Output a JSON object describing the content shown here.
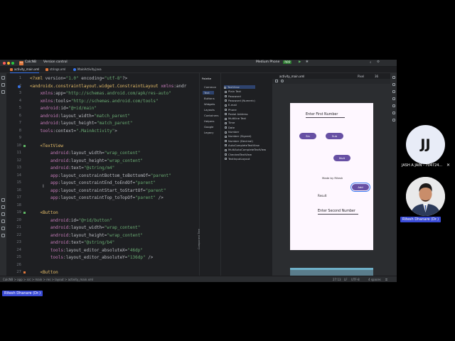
{
  "window": {
    "project_badge": "CA",
    "project_name": "CalcNB",
    "vcs": "Version control",
    "device": "Medium Phone",
    "run_config": "app"
  },
  "tabs": [
    {
      "label": "activity_main.xml",
      "active": true,
      "color": "#e0763a"
    },
    {
      "label": "strings.xml",
      "active": false,
      "color": "#e0763a"
    },
    {
      "label": "MainActivity.java",
      "active": false,
      "color": "#3574f0"
    }
  ],
  "code": {
    "line_numbers": [
      "1",
      "2",
      "3",
      "4",
      "5",
      "6",
      "7",
      "8",
      "9",
      "10",
      "11",
      "12",
      "13",
      "14",
      "15",
      "16",
      "17",
      "18",
      "19",
      "20",
      "21",
      "22",
      "23",
      "24",
      "25",
      "26",
      "27"
    ],
    "lines": [
      "<?xml version=\"1.0\" encoding=\"utf-8\"?>",
      "<androidx.constraintlayout.widget.ConstraintLayout xmlns:andr",
      "    xmlns:app=\"http://schemas.android.com/apk/res-auto\"",
      "    xmlns:tools=\"http://schemas.android.com/tools\"",
      "    android:id=\"@+id/main\"",
      "    android:layout_width=\"match_parent\"",
      "    android:layout_height=\"match_parent\"",
      "    tools:context=\".MainActivity\">",
      "",
      "    <TextView",
      "        android:layout_width=\"wrap_content\"",
      "        android:layout_height=\"wrap_content\"",
      "        android:text=\"@string/m4\"",
      "        app:layout_constraintBottom_toBottomOf=\"parent\"",
      "        app:layout_constraintEnd_toEndOf=\"parent\"",
      "        app:layout_constraintStart_toStartOf=\"parent\"",
      "        app:layout_constraintTop_toTopOf=\"parent\" />",
      "",
      "    <Button",
      "        android:id=\"@+id/button\"",
      "        android:layout_width=\"wrap_content\"",
      "        android:layout_height=\"wrap_content\"",
      "        android:text=\"@string/b4\"",
      "        tools:layout_editor_absoluteX=\"46dp\"",
      "        tools:layout_editor_absoluteY=\"136dp\" />",
      "",
      "    <Button"
    ]
  },
  "palette": {
    "title": "Palette",
    "categories": [
      "Common",
      "Text",
      "Buttons",
      "Widgets",
      "Layouts",
      "Containers",
      "Helpers",
      "Google",
      "Legacy"
    ],
    "selected_category": "Text",
    "items": [
      "TextView",
      "Plain Text",
      "Password",
      "Password (Numeric)",
      "E-mail",
      "Phone",
      "Postal Address",
      "Multiline Text",
      "Time",
      "Date",
      "Number",
      "Number (Signed)",
      "Number (Decimal)",
      "AutoCompleteTextView",
      "MultiAutoCompleteTextView",
      "CheckedTextView",
      "TextInputLayout"
    ],
    "selected_item": "TextView",
    "component_tree_label": "Component Tree"
  },
  "designer": {
    "file_tab": "activity_main.xml",
    "device": "Pixel",
    "api": "36",
    "preview": {
      "first_field": "Enter First Number",
      "btn_sin": "Sin",
      "btn_sub": "Sub",
      "btn_mult": "Mult",
      "made_by": "Made by Ritesh",
      "btn_add": "Add",
      "result_label": "Result",
      "second_field": "Enter Second Number"
    }
  },
  "status_bar": {
    "breadcrumb": "CalcNB > app > src > main > res > layout > activity_main.xml",
    "position": "27:13",
    "line_sep": "LF",
    "encoding": "UTF-8",
    "indent": "4 spaces"
  },
  "participants": {
    "left_badge": "Ritesh Dhanare (Dr.)",
    "jj_initials": "JJ",
    "jj_name": "JASH A JAIN - 704724...",
    "photo_name": "Ritesh Dhanare (Dr.)"
  },
  "colors": {
    "accent": "#3574f0",
    "button": "#6750a4",
    "badge": "#3a4bd6"
  }
}
